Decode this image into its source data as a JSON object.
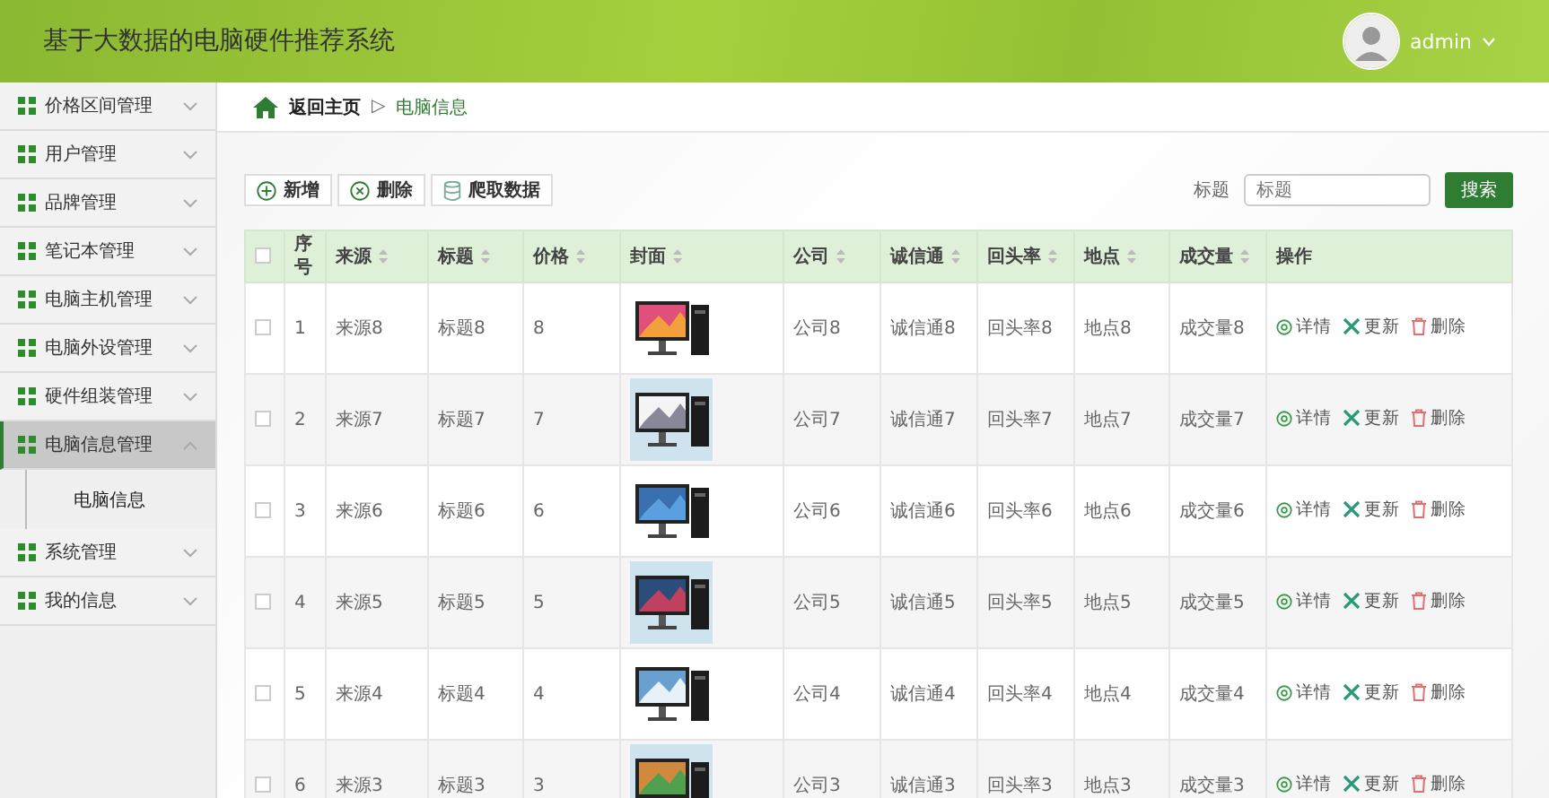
{
  "header": {
    "title": "基于大数据的电脑硬件推荐系统",
    "user": "admin"
  },
  "sidebar": {
    "items": [
      {
        "label": "价格区间管理",
        "selected": false,
        "expanded": false
      },
      {
        "label": "用户管理",
        "selected": false,
        "expanded": false
      },
      {
        "label": "品牌管理",
        "selected": false,
        "expanded": false
      },
      {
        "label": "笔记本管理",
        "selected": false,
        "expanded": false
      },
      {
        "label": "电脑主机管理",
        "selected": false,
        "expanded": false
      },
      {
        "label": "电脑外设管理",
        "selected": false,
        "expanded": false
      },
      {
        "label": "硬件组装管理",
        "selected": false,
        "expanded": false
      },
      {
        "label": "电脑信息管理",
        "selected": true,
        "expanded": true,
        "children": [
          {
            "label": "电脑信息"
          }
        ]
      },
      {
        "label": "系统管理",
        "selected": false,
        "expanded": false
      },
      {
        "label": "我的信息",
        "selected": false,
        "expanded": false
      }
    ]
  },
  "breadcrumb": {
    "home": "返回主页",
    "separator": "▷",
    "current": "电脑信息"
  },
  "toolbar": {
    "buttons": [
      {
        "label": "新增",
        "kind": "add"
      },
      {
        "label": "删除",
        "kind": "remove"
      },
      {
        "label": "爬取数据",
        "kind": "crawl"
      }
    ],
    "search": {
      "label": "标题",
      "placeholder": "标题",
      "button": "搜索"
    }
  },
  "table": {
    "columns": [
      {
        "label": "序号",
        "sortable": false
      },
      {
        "label": "来源",
        "sortable": true
      },
      {
        "label": "标题",
        "sortable": true
      },
      {
        "label": "价格",
        "sortable": true
      },
      {
        "label": "封面",
        "sortable": true
      },
      {
        "label": "公司",
        "sortable": true
      },
      {
        "label": "诚信通",
        "sortable": true
      },
      {
        "label": "回头率",
        "sortable": true
      },
      {
        "label": "地点",
        "sortable": true
      },
      {
        "label": "成交量",
        "sortable": true
      },
      {
        "label": "操作",
        "sortable": false
      }
    ],
    "all_checked": false,
    "rows": [
      {
        "checked": false,
        "cells": [
          "1",
          "来源8",
          "标题8",
          "8",
          "",
          "公司8",
          "诚信通8",
          "回头率8",
          "地点8",
          "成交量8"
        ],
        "actions": [
          "详情",
          "更新",
          "删除"
        ]
      },
      {
        "checked": false,
        "cells": [
          "2",
          "来源7",
          "标题7",
          "7",
          "",
          "公司7",
          "诚信通7",
          "回头率7",
          "地点7",
          "成交量7"
        ],
        "actions": [
          "详情",
          "更新",
          "删除"
        ]
      },
      {
        "checked": false,
        "cells": [
          "3",
          "来源6",
          "标题6",
          "6",
          "",
          "公司6",
          "诚信通6",
          "回头率6",
          "地点6",
          "成交量6"
        ],
        "actions": [
          "详情",
          "更新",
          "删除"
        ]
      },
      {
        "checked": false,
        "cells": [
          "4",
          "来源5",
          "标题5",
          "5",
          "",
          "公司5",
          "诚信通5",
          "回头率5",
          "地点5",
          "成交量5"
        ],
        "actions": [
          "详情",
          "更新",
          "删除"
        ]
      },
      {
        "checked": false,
        "cells": [
          "5",
          "来源4",
          "标题4",
          "4",
          "",
          "公司4",
          "诚信通4",
          "回头率4",
          "地点4",
          "成交量4"
        ],
        "actions": [
          "详情",
          "更新",
          "删除"
        ]
      },
      {
        "checked": false,
        "cells": [
          "6",
          "来源3",
          "标题3",
          "3",
          "",
          "公司3",
          "诚信通3",
          "回头率3",
          "地点3",
          "成交量3"
        ],
        "actions": [
          "详情",
          "更新",
          "删除"
        ]
      }
    ]
  }
}
